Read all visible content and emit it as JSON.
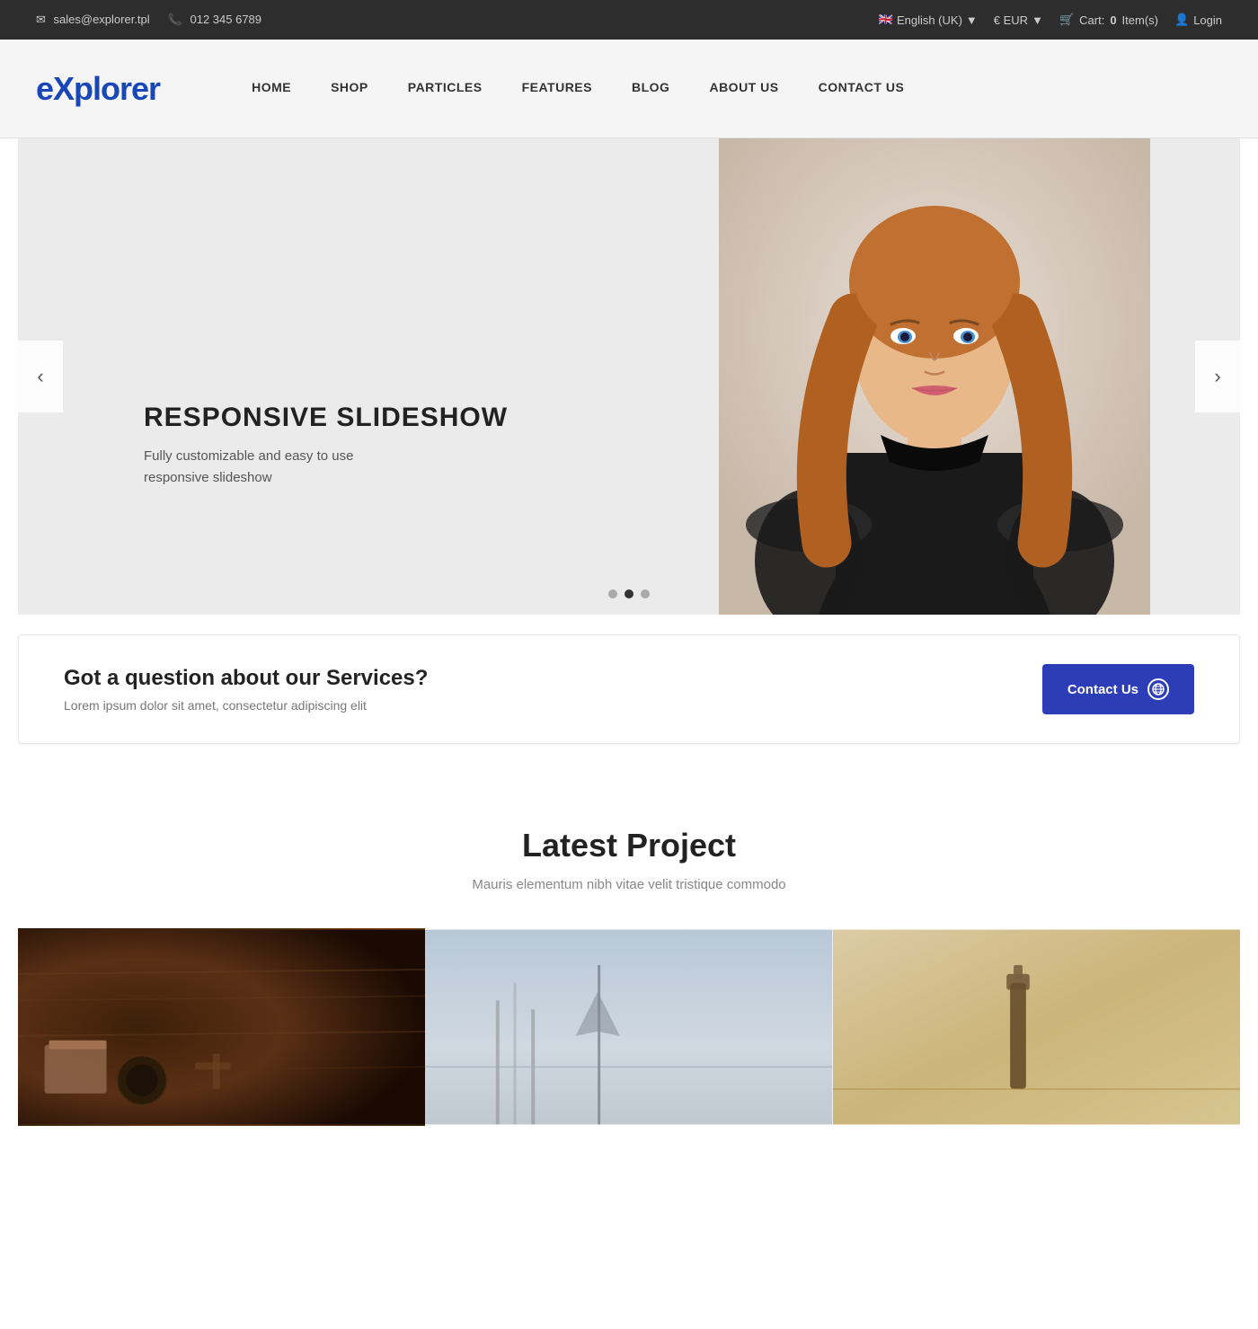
{
  "topbar": {
    "email": "sales@explorer.tpl",
    "phone": "012 345 6789",
    "language": "English (UK)",
    "currency": "€ EUR",
    "cart_label": "Cart:",
    "cart_count": "0",
    "cart_unit": "Item(s)",
    "login_label": "Login"
  },
  "header": {
    "logo_text_e": "e",
    "logo_text_xplorer": "xplorer",
    "nav": [
      {
        "label": "HOME",
        "id": "nav-home"
      },
      {
        "label": "SHOP",
        "id": "nav-shop"
      },
      {
        "label": "PARTICLES",
        "id": "nav-particles"
      },
      {
        "label": "FEATURES",
        "id": "nav-features"
      },
      {
        "label": "BLOG",
        "id": "nav-blog"
      },
      {
        "label": "ABOUT US",
        "id": "nav-about"
      },
      {
        "label": "CONTACT US",
        "id": "nav-contact"
      }
    ]
  },
  "slideshow": {
    "title": "RESPONSIVE SLIDESHOW",
    "description_line1": "Fully customizable and easy to use",
    "description_line2": "responsive slideshow",
    "prev_label": "‹",
    "next_label": "›"
  },
  "services": {
    "heading": "Got a question about our Services?",
    "subtext": "Lorem ipsum dolor sit amet, consectetur adipiscing elit",
    "button_label": "Contact Us"
  },
  "latest_project": {
    "heading": "Latest Project",
    "subtext": "Mauris elementum nibh vitae velit tristique commodo"
  }
}
